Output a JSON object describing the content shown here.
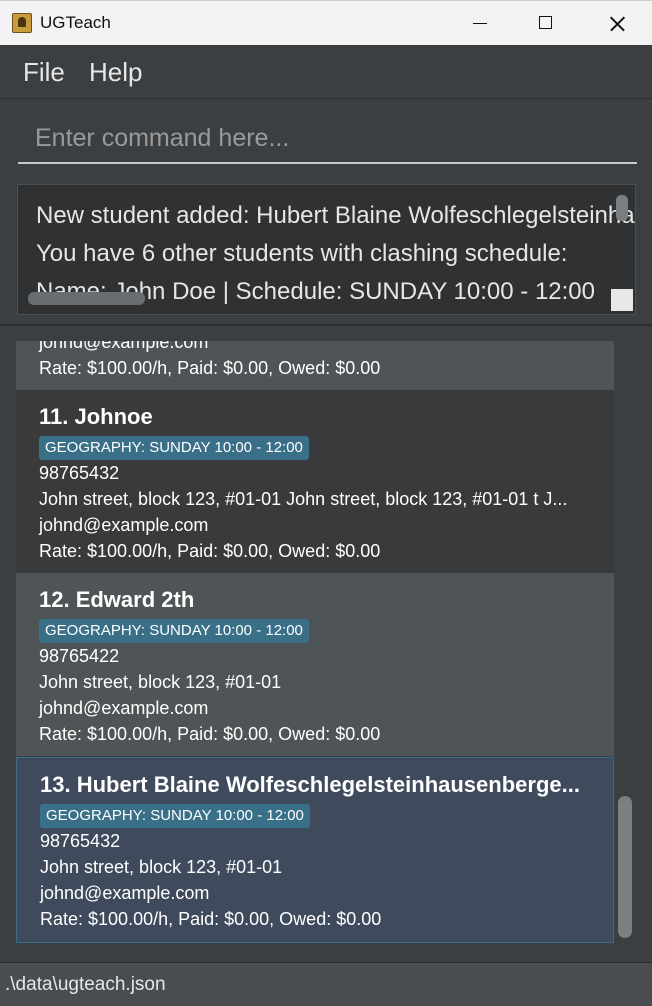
{
  "window": {
    "title": "UGTeach"
  },
  "menu": {
    "file": "File",
    "help": "Help"
  },
  "command": {
    "placeholder": "Enter command here..."
  },
  "result": {
    "lines": [
      "New student added: Hubert Blaine Wolfeschlegelsteinhausenbergerdorff Sr.",
      "You have 6 other students with clashing schedule:",
      "Name: John Doe | Schedule: SUNDAY 10:00 - 12:00"
    ]
  },
  "students": [
    {
      "email": "johnd@example.com",
      "rate_line": "Rate: $100.00/h, Paid: $0.00, Owed: $0.00"
    },
    {
      "title": "11. Johnoe",
      "tag": "GEOGRAPHY: SUNDAY 10:00 - 12:00",
      "phone": "98765432",
      "address": "John street, block 123, #01-01 John street, block 123, #01-01 t J...",
      "email": "johnd@example.com",
      "rate_line": "Rate: $100.00/h, Paid: $0.00, Owed: $0.00"
    },
    {
      "title": "12. Edward 2th",
      "tag": "GEOGRAPHY: SUNDAY 10:00 - 12:00",
      "phone": "98765422",
      "address": "John street, block 123, #01-01",
      "email": "johnd@example.com",
      "rate_line": "Rate: $100.00/h, Paid: $0.00, Owed: $0.00"
    },
    {
      "title": "13. Hubert Blaine Wolfeschlegelsteinhausenberge...",
      "tag": "GEOGRAPHY: SUNDAY 10:00 - 12:00",
      "phone": "98765432",
      "address": "John street, block 123, #01-01",
      "email": "johnd@example.com",
      "rate_line": "Rate: $100.00/h, Paid: $0.00, Owed: $0.00"
    }
  ],
  "status": {
    "path": ".\\data\\ugteach.json"
  }
}
